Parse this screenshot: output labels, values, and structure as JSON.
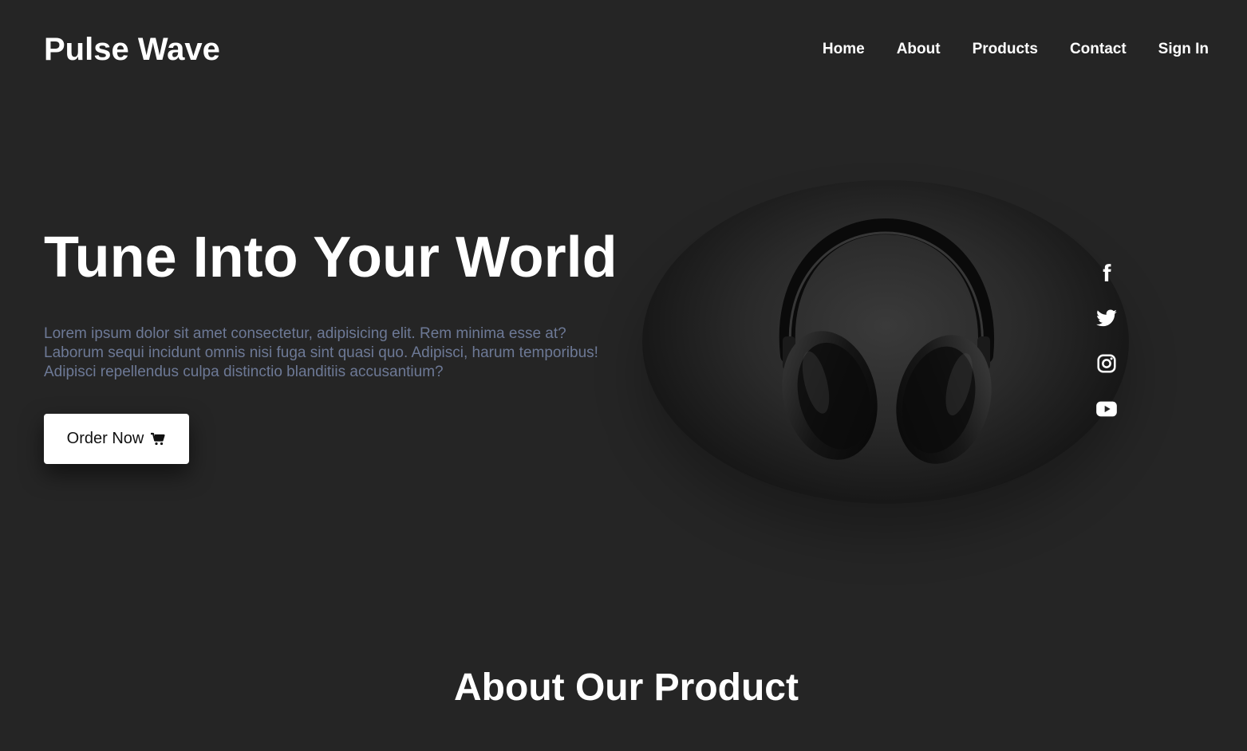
{
  "brand": {
    "name": "Pulse Wave"
  },
  "nav": {
    "items": [
      {
        "label": "Home"
      },
      {
        "label": "About"
      },
      {
        "label": "Products"
      },
      {
        "label": "Contact"
      },
      {
        "label": "Sign In"
      }
    ]
  },
  "hero": {
    "title": "Tune Into Your World",
    "description": "Lorem ipsum dolor sit amet consectetur, adipisicing elit. Rem minima esse at? Laborum sequi incidunt omnis nisi fuga sint quasi quo. Adipisci, harum temporibus! Adipisci repellendus culpa distinctio blanditiis accusantium?",
    "cta_label": "Order Now",
    "cta_icon": "cart-icon",
    "image": "headphones-image"
  },
  "social": [
    {
      "icon": "facebook-icon"
    },
    {
      "icon": "twitter-icon"
    },
    {
      "icon": "instagram-icon"
    },
    {
      "icon": "youtube-icon"
    }
  ],
  "about": {
    "title": "About Our Product"
  },
  "colors": {
    "background": "#252525",
    "text": "#ffffff",
    "muted_text": "#6d7996",
    "button_bg": "#ffffff",
    "button_text": "#111111"
  }
}
